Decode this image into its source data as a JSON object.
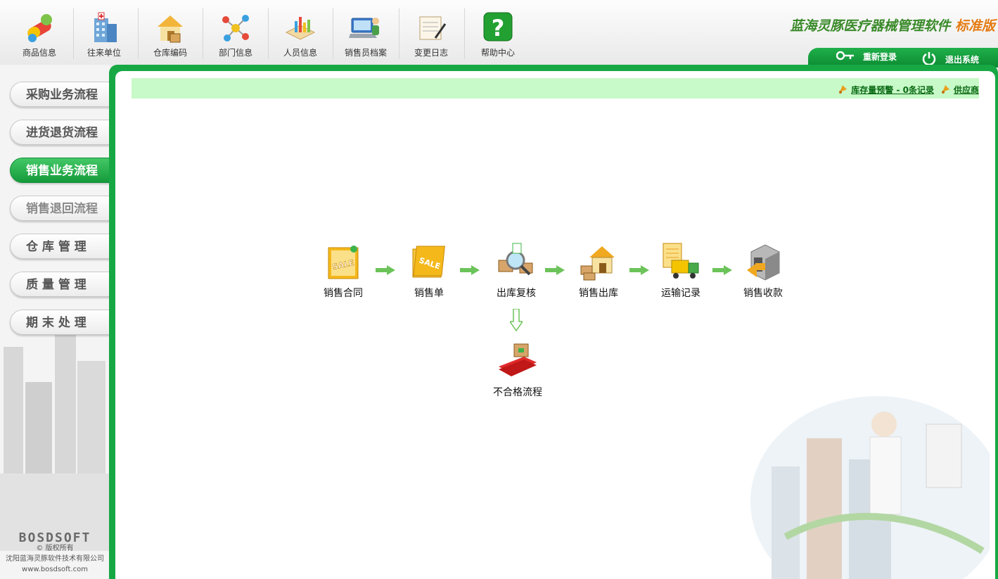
{
  "toolbar": {
    "items": [
      {
        "label": "商品信息",
        "icon": "medicine-icon"
      },
      {
        "label": "往来单位",
        "icon": "hospital-icon"
      },
      {
        "label": "仓库编码",
        "icon": "warehouse-icon"
      },
      {
        "label": "部门信息",
        "icon": "molecule-icon"
      },
      {
        "label": "人员信息",
        "icon": "people-chart-icon"
      },
      {
        "label": "销售员档案",
        "icon": "salesman-laptop-icon"
      },
      {
        "label": "变更日志",
        "icon": "notepad-icon"
      },
      {
        "label": "帮助中心",
        "icon": "help-icon"
      }
    ]
  },
  "brand": {
    "title": "蓝海灵豚医疗器械管理软件",
    "edition": "标准版"
  },
  "account": {
    "relogin": "重新登录",
    "logout": "退出系统"
  },
  "sidebar": {
    "items": [
      {
        "label": "采购业务流程",
        "state": "normal"
      },
      {
        "label": "进货退货流程",
        "state": "normal"
      },
      {
        "label": "销售业务流程",
        "state": "active"
      },
      {
        "label": "销售退回流程",
        "state": "dim"
      },
      {
        "label": "仓 库 管 理",
        "state": "normal"
      },
      {
        "label": "质 量 管 理",
        "state": "normal"
      },
      {
        "label": "期 末 处 理",
        "state": "normal"
      }
    ]
  },
  "footer": {
    "logo": "BOSDSOFT",
    "copyright": "© 版权所有",
    "company": "沈阳蓝海灵豚软件技术有限公司",
    "url": "www.bosdsoft.com"
  },
  "alerts": [
    {
      "label": "库存量预警 - 0条记录"
    },
    {
      "label": "供应商"
    }
  ],
  "flow": {
    "steps": [
      {
        "label": "销售合同",
        "icon": "sale-contract-icon"
      },
      {
        "label": "销售单",
        "icon": "sale-folder-icon"
      },
      {
        "label": "出库复核",
        "icon": "inspection-icon"
      },
      {
        "label": "销售出库",
        "icon": "house-outbound-icon"
      },
      {
        "label": "运输记录",
        "icon": "truck-icon"
      },
      {
        "label": "销售收款",
        "icon": "safe-payment-icon"
      }
    ],
    "branch": {
      "label": "不合格流程",
      "icon": "rejected-goods-icon"
    }
  },
  "colors": {
    "accent": "#17a844",
    "alert_bg": "#c8f9c8",
    "brand_green": "#3a8a2a",
    "brand_orange": "#e57b12"
  }
}
